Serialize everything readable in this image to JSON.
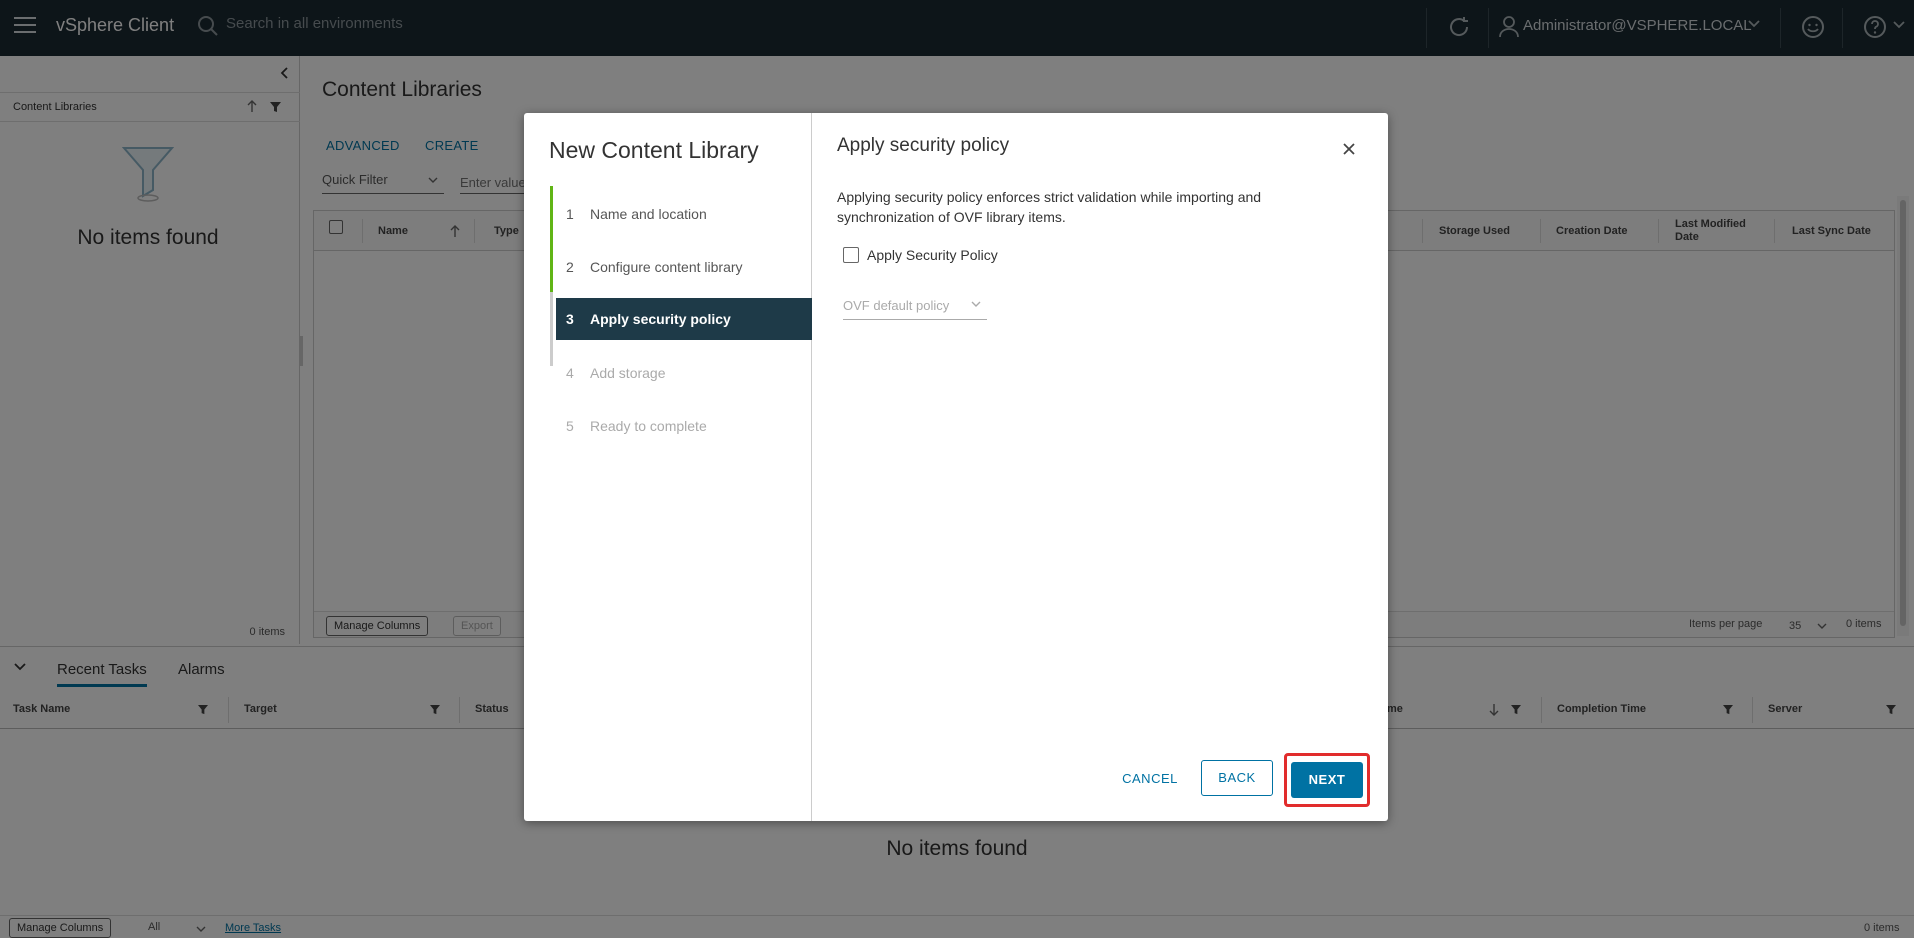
{
  "header": {
    "brand": "vSphere Client",
    "search_placeholder": "Search in all environments",
    "user": "Administrator@VSPHERE.LOCAL"
  },
  "left_panel": {
    "title": "Content Libraries",
    "empty": "No items found",
    "count": "0 items"
  },
  "main": {
    "title": "Content Libraries",
    "actions": [
      "ADVANCED",
      "CREATE"
    ],
    "quick_filter": "Quick Filter",
    "filter_placeholder": "Enter value",
    "columns": {
      "name": "Name",
      "type": "Type",
      "storage_used": "Storage Used",
      "creation_date": "Creation Date",
      "last_modified": "Last Modified Date",
      "last_sync": "Last Sync Date"
    },
    "footer": {
      "manage_columns": "Manage Columns",
      "export": "Export",
      "items_per_page_label": "Items per page",
      "items_per_page": "35",
      "count": "0 items"
    }
  },
  "bottom": {
    "tabs": [
      "Recent Tasks",
      "Alarms"
    ],
    "columns": {
      "task_name": "Task Name",
      "target": "Target",
      "status": "Status",
      "time": "me",
      "completion_time": "Completion Time",
      "server": "Server"
    },
    "empty": "No items found",
    "footer": {
      "manage_columns": "Manage Columns",
      "filter": "All",
      "more_tasks": "More Tasks",
      "count": "0 items"
    }
  },
  "wizard": {
    "title": "New Content Library",
    "steps": [
      {
        "num": "1",
        "label": "Name and location"
      },
      {
        "num": "2",
        "label": "Configure content library"
      },
      {
        "num": "3",
        "label": "Apply security policy"
      },
      {
        "num": "4",
        "label": "Add storage"
      },
      {
        "num": "5",
        "label": "Ready to complete"
      }
    ],
    "content": {
      "title": "Apply security policy",
      "description": "Applying security policy enforces strict validation while importing and synchronization of OVF library items.",
      "checkbox_label": "Apply Security Policy",
      "checkbox_checked": false,
      "policy_select": "OVF default policy"
    },
    "buttons": {
      "cancel": "CANCEL",
      "back": "BACK",
      "next": "NEXT"
    }
  },
  "colors": {
    "header_bg": "#1b2a32",
    "accent": "#0072a3",
    "step_done": "#60b515",
    "step_active_bg": "#1e3a48",
    "highlight": "#e12c2c"
  }
}
